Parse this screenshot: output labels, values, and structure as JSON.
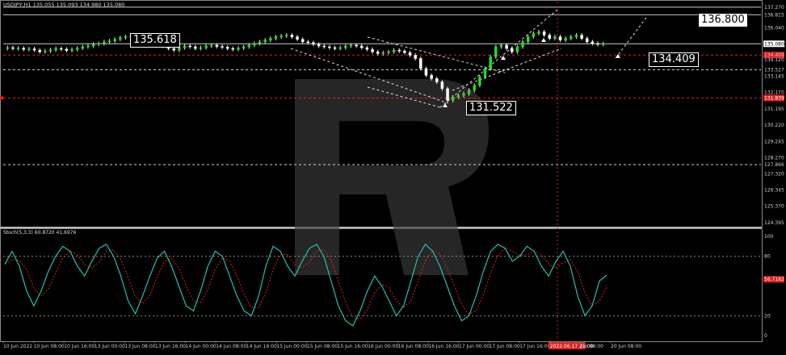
{
  "header": {
    "symbol_line": "USDJPY,H1  135.055 135.093 134.980 135.080"
  },
  "stoch_header": "Stoch(5,3,3) 60.8720 41.6976",
  "callouts": {
    "high_left": "135.618",
    "target_top": "136.800",
    "target_mid": "134.409",
    "low": "131.522"
  },
  "price_axis": {
    "labels": [
      "137.270",
      "136.815",
      "136.040",
      "135.080",
      "134.409",
      "134.120",
      "133.527",
      "133.145",
      "132.170",
      "131.195",
      "130.220",
      "129.245",
      "128.270",
      "127.866",
      "127.320",
      "126.345",
      "125.370",
      "124.395"
    ],
    "current_price": "135.080",
    "red_tag_upper": "134.409",
    "red_tag_lower": "131.839"
  },
  "stoch_axis": {
    "labels": [
      "100",
      "80",
      "56.7182",
      "20",
      "0"
    ],
    "red_tag": "56.7182"
  },
  "time_axis": {
    "labels": [
      "10 Jun 2022",
      "10 Jun 08:00",
      "10 Jun 16:00",
      "13 Jun 00:00",
      "13 Jun 08:00",
      "13 Jun 16:00",
      "14 Jun 00:00",
      "14 Jun 08:00",
      "14 Jun 16:00",
      "15 Jun 00:00",
      "15 Jun 08:00",
      "15 Jun 16:00",
      "16 Jun 00:00",
      "16 Jun 08:00",
      "16 Jun 16:00",
      "17 Jun 00:00",
      "17 Jun 08:00",
      "17 Jun 16:00",
      "2022.06.17 21:00",
      "Jun 08:00",
      "20 Jun 08:00"
    ],
    "highlight": "2022.06.17 21:00"
  },
  "chart_data": {
    "type": "candlestick",
    "symbol": "USDJPY",
    "timeframe": "H1",
    "ohlc_header": {
      "open": 135.055,
      "high": 135.093,
      "low": 134.98,
      "close": 135.08
    },
    "close_approx": [
      134.85,
      134.8,
      134.82,
      134.75,
      134.78,
      134.7,
      134.6,
      134.65,
      134.72,
      134.8,
      134.76,
      134.68,
      134.74,
      134.82,
      134.9,
      134.95,
      135.05,
      135.1,
      135.2,
      135.25,
      135.35,
      135.45,
      135.5,
      135.55,
      135.6,
      135.58,
      135.4,
      135.3,
      135.1,
      134.95,
      134.8,
      134.7,
      134.85,
      134.95,
      134.9,
      134.8,
      134.85,
      134.95,
      135.0,
      134.92,
      134.88,
      134.8,
      134.75,
      134.82,
      134.9,
      135.0,
      135.1,
      135.2,
      135.3,
      135.4,
      135.5,
      135.55,
      135.6,
      135.5,
      135.35,
      135.2,
      135.15,
      135.05,
      134.95,
      134.9,
      134.85,
      134.8,
      134.85,
      134.95,
      135.0,
      134.95,
      134.85,
      134.75,
      134.6,
      134.5,
      134.55,
      134.6,
      134.7,
      134.65,
      134.55,
      134.4,
      134.2,
      133.6,
      133.2,
      133.0,
      132.8,
      132.4,
      131.7,
      131.9,
      132.0,
      132.1,
      132.3,
      132.6,
      133.1,
      133.6,
      134.3,
      134.9,
      135.0,
      134.8,
      134.6,
      134.9,
      135.2,
      135.5,
      135.7,
      135.8,
      135.6,
      135.4,
      135.5,
      135.3,
      135.4,
      135.5,
      135.6,
      135.4,
      135.2,
      135.1,
      135.05,
      135.08
    ],
    "key_levels": [
      137.27,
      136.815,
      135.08,
      134.409,
      133.527,
      131.839,
      127.866
    ],
    "annotations": [
      {
        "label": "135.618",
        "price": 135.618
      },
      {
        "label": "136.800",
        "price": 136.8
      },
      {
        "label": "134.409",
        "price": 134.409
      },
      {
        "label": "131.522",
        "price": 131.522
      }
    ],
    "stochastic": {
      "params": "5,3,3",
      "main_value": 60.872,
      "signal_value": 41.6976,
      "levels": [
        80,
        20
      ],
      "main_approx": [
        72,
        85,
        70,
        45,
        30,
        45,
        65,
        80,
        90,
        85,
        70,
        60,
        75,
        88,
        92,
        80,
        60,
        35,
        22,
        40,
        60,
        78,
        85,
        70,
        50,
        30,
        25,
        45,
        70,
        85,
        80,
        60,
        40,
        25,
        20,
        40,
        70,
        90,
        85,
        70,
        60,
        75,
        88,
        92,
        80,
        55,
        30,
        15,
        10,
        25,
        45,
        60,
        50,
        35,
        20,
        30,
        55,
        80,
        92,
        85,
        70,
        50,
        30,
        15,
        20,
        40,
        65,
        85,
        92,
        88,
        75,
        80,
        90,
        85,
        70,
        60,
        75,
        85,
        70,
        40,
        20,
        30,
        55,
        61
      ]
    }
  }
}
